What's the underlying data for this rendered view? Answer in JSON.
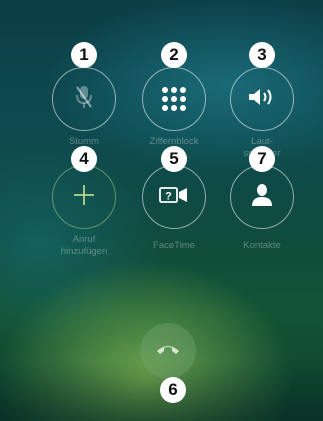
{
  "buttons": {
    "mute": {
      "label": "Stumm",
      "badge": "1",
      "icon": "mic-muted-icon"
    },
    "keypad": {
      "label": "Ziffernblock",
      "badge": "2",
      "icon": "keypad-icon"
    },
    "speaker": {
      "label": "Laut-\nsprecher",
      "badge": "3",
      "icon": "speaker-icon"
    },
    "add_call": {
      "label": "Anruf\nhinzufügen",
      "badge": "4",
      "icon": "plus-icon"
    },
    "facetime": {
      "label": "FaceTime",
      "badge": "5",
      "icon": "facetime-icon"
    },
    "contacts": {
      "label": "Kontakte",
      "badge": "7",
      "icon": "contact-icon"
    }
  },
  "end_call": {
    "badge": "6",
    "icon": "end-call-icon"
  },
  "colors": {
    "badge_bg": "#ffffff",
    "ring": "#ffffff",
    "label": "#ffffff",
    "add_ring": "#c8e18c"
  }
}
